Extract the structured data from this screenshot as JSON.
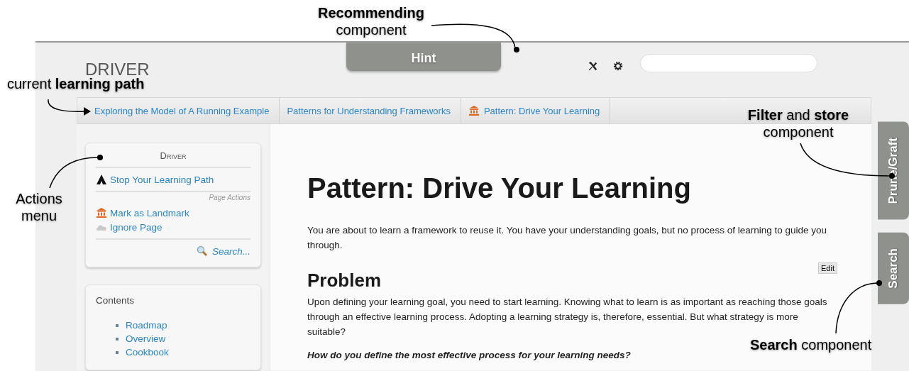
{
  "annotations": [
    {
      "lines": [
        "**Recommending**",
        "component"
      ]
    },
    {
      "lines": [
        "current **learning path**"
      ]
    },
    {
      "lines": [
        "**Filter** and **store**",
        "component"
      ]
    },
    {
      "lines": [
        "Actions",
        "menu"
      ]
    },
    {
      "lines": [
        "**Search** component"
      ]
    }
  ],
  "header": {
    "logo": "DRIVER",
    "hint_tab": "Hint"
  },
  "breadcrumbs": [
    {
      "kind": "plain",
      "label": "Exploring the Model of A Running Example"
    },
    {
      "kind": "plain",
      "label": "Patterns for Understanding Frameworks"
    },
    {
      "kind": "landmark",
      "label": "Pattern: Drive Your Learning"
    }
  ],
  "actions_card": {
    "title": "Driver",
    "path_items": [
      {
        "kind": "path",
        "label": "Stop Your Learning Path"
      }
    ],
    "section_label": "Page Actions",
    "page_items": [
      {
        "kind": "landmark",
        "label": "Mark as Landmark"
      },
      {
        "kind": "ignore",
        "label": "Ignore Page"
      }
    ],
    "search_link": "Search..."
  },
  "contents": {
    "title": "Contents",
    "items": [
      "Roadmap",
      "Overview",
      "Cookbook"
    ]
  },
  "article": {
    "title": "Pattern: Drive Your Learning",
    "intro": "You are about to learn a framework to reuse it. You have your understanding goals, but no process of learning to guide you through.",
    "edit_button": "Edit",
    "sections": [
      {
        "heading": "Problem",
        "body": "Upon defining your learning goal, you need to start learning. Knowing what to learn is as important as reaching those goals through an effective learning process. Adopting a learning strategy is, therefore, essential. But what strategy is more suitable?",
        "question": "How do you define the most effective process for your learning needs?"
      }
    ]
  },
  "side_tabs": [
    "Prune/Graft",
    "Search"
  ]
}
